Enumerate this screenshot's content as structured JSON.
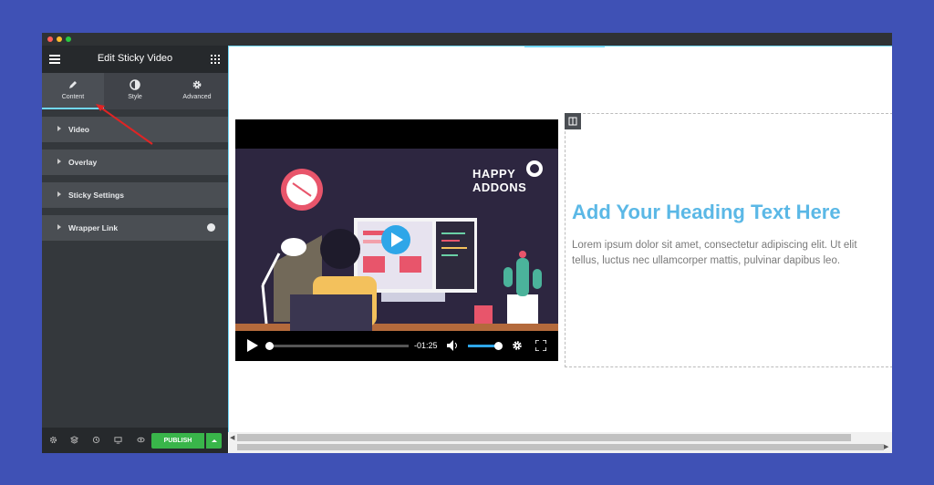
{
  "window": {
    "dots": [
      "#ff5f57",
      "#febc2e",
      "#28c840"
    ]
  },
  "panel": {
    "title": "Edit Sticky Video",
    "tabs": [
      {
        "label": "Content",
        "icon": "pencil-icon",
        "active": true
      },
      {
        "label": "Style",
        "icon": "contrast-icon"
      },
      {
        "label": "Advanced",
        "icon": "gear-icon"
      }
    ],
    "sections": [
      {
        "label": "Video"
      },
      {
        "label": "Overlay"
      },
      {
        "label": "Sticky Settings"
      },
      {
        "label": "Wrapper Link",
        "badge_icon": "pro-icon"
      }
    ],
    "footer": {
      "icons": [
        "settings-icon",
        "layers-icon",
        "history-icon",
        "responsive-icon",
        "preview-icon"
      ],
      "publish_label": "PUBLISH"
    }
  },
  "video": {
    "brand_line1": "HAPPY",
    "brand_line2": "ADDONS",
    "time": "-01:25",
    "progress": 0.0,
    "volume": 1.0
  },
  "content": {
    "heading": "Add Your Heading Text Here",
    "paragraph": "Lorem ipsum dolor sit amet, consectetur adipiscing elit. Ut elit tellus, luctus nec ullamcorper mattis, pulvinar dapibus leo."
  },
  "colors": {
    "accent": "#71d7f7",
    "heading": "#5bb8e6",
    "publish": "#39b54a",
    "annotation_arrow": "#e02424",
    "background": "#3f51b5"
  }
}
